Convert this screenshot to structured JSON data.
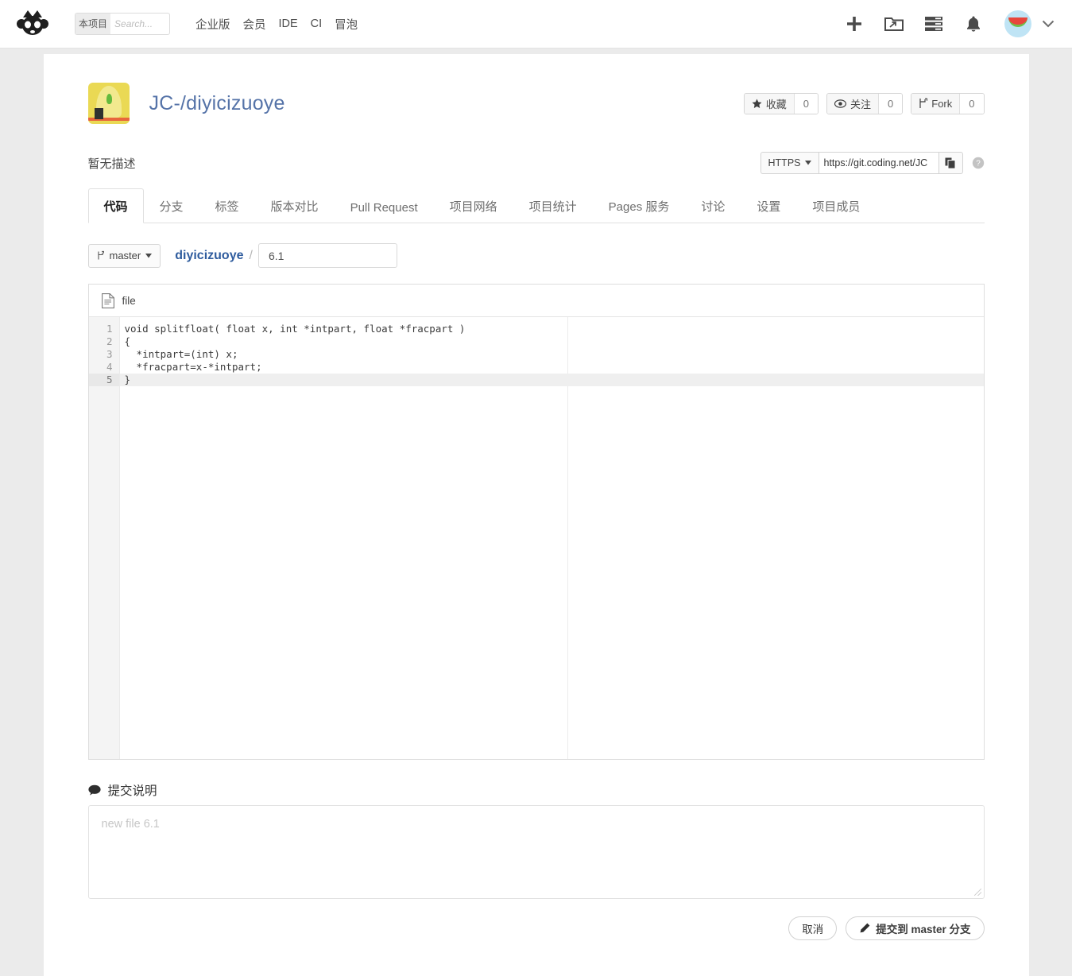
{
  "navbar": {
    "logo_name": "coding-mascot-logo",
    "search": {
      "scope": "本项目",
      "placeholder": "Search...",
      "value": ""
    },
    "links": [
      {
        "label": "企业版",
        "name": "nav-enterprise"
      },
      {
        "label": "会员",
        "name": "nav-member"
      },
      {
        "label": "IDE",
        "name": "nav-ide"
      },
      {
        "label": "CI",
        "name": "nav-ci"
      },
      {
        "label": "冒泡",
        "name": "nav-bubble"
      }
    ],
    "icons": [
      {
        "name": "plus-icon"
      },
      {
        "name": "project-folder-icon"
      },
      {
        "name": "task-list-icon"
      },
      {
        "name": "notification-bell-icon"
      }
    ],
    "avatar_name": "user-avatar-watermelon",
    "caret_name": "chevron-down-icon"
  },
  "project": {
    "title": "JC-/diyicizuoye",
    "avatar_name": "project-avatar",
    "stats": [
      {
        "icon": "star-icon",
        "label": "收藏",
        "count": "0"
      },
      {
        "icon": "eye-icon",
        "label": "关注",
        "count": "0"
      },
      {
        "icon": "fork-icon",
        "label": "Fork",
        "count": "0"
      }
    ],
    "description": "暂无描述",
    "clone": {
      "protocol": "HTTPS",
      "url": "https://git.coding.net/JC",
      "copy_icon": "copy-icon",
      "help_icon": "question-circle-icon"
    }
  },
  "tabs": [
    {
      "label": "代码",
      "active": true
    },
    {
      "label": "分支",
      "active": false
    },
    {
      "label": "标签",
      "active": false
    },
    {
      "label": "版本对比",
      "active": false
    },
    {
      "label": "Pull Request",
      "active": false
    },
    {
      "label": "项目网络",
      "active": false
    },
    {
      "label": "项目统计",
      "active": false
    },
    {
      "label": "Pages 服务",
      "active": false
    },
    {
      "label": "讨论",
      "active": false
    },
    {
      "label": "设置",
      "active": false
    },
    {
      "label": "项目成员",
      "active": false
    }
  ],
  "breadcrumb": {
    "branch": "master",
    "repo": "diyicizuoye",
    "separator": "/",
    "filename_value": "6.1"
  },
  "editor": {
    "tab_label": "file",
    "tab_icon": "file-document-icon",
    "lines": [
      {
        "no": "1",
        "text": "void splitfloat( float x, int *intpart, float *fracpart )",
        "current": false
      },
      {
        "no": "2",
        "text": "{",
        "current": false
      },
      {
        "no": "3",
        "text": "  *intpart=(int) x;",
        "current": false
      },
      {
        "no": "4",
        "text": "  *fracpart=x-*intpart;",
        "current": false
      },
      {
        "no": "5",
        "text": "}",
        "current": true
      }
    ]
  },
  "commit": {
    "label": "提交说明",
    "label_icon": "comment-bubble-icon",
    "placeholder": "new file 6.1",
    "value": ""
  },
  "actions": {
    "cancel_label": "取消",
    "submit_label": "提交到 master 分支",
    "submit_icon": "pencil-icon"
  }
}
